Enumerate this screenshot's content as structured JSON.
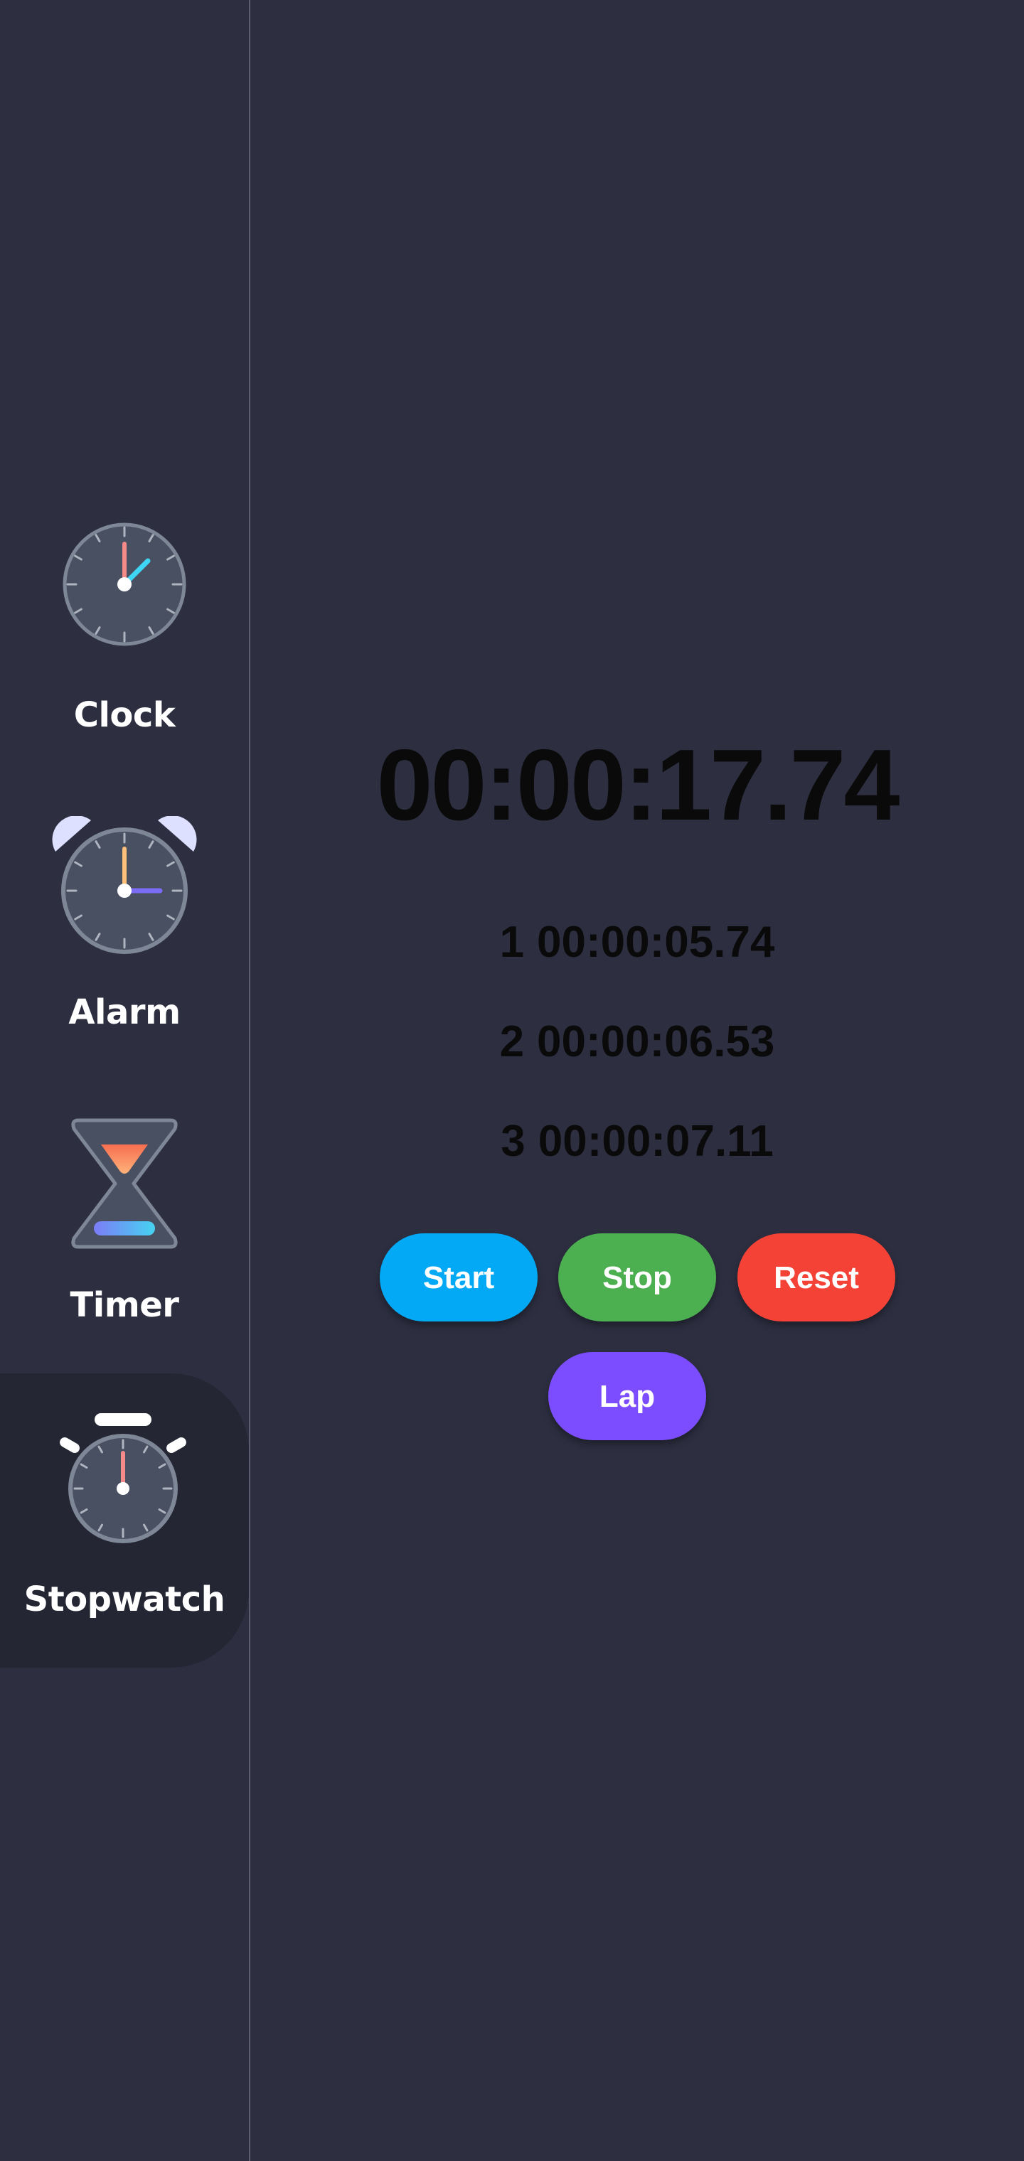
{
  "nav": {
    "items": [
      {
        "label": "Clock",
        "icon": "clock-icon",
        "active": false
      },
      {
        "label": "Alarm",
        "icon": "alarm-clock-icon",
        "active": false
      },
      {
        "label": "Timer",
        "icon": "hourglass-icon",
        "active": false
      },
      {
        "label": "Stopwatch",
        "icon": "stopwatch-icon",
        "active": true
      }
    ]
  },
  "stopwatch": {
    "elapsed": "00:00:17.74",
    "laps": [
      {
        "number": "1",
        "time": "00:00:05.74"
      },
      {
        "number": "2",
        "time": "00:00:06.53"
      },
      {
        "number": "3",
        "time": "00:00:07.11"
      }
    ]
  },
  "buttons": {
    "start": "Start",
    "stop": "Stop",
    "reset": "Reset",
    "lap": "Lap"
  },
  "colors": {
    "background": "#2d2f41",
    "active_nav": "#242634",
    "start": "#03a9f4",
    "stop": "#4caf50",
    "reset": "#f44336",
    "lap": "#7c4dff"
  }
}
